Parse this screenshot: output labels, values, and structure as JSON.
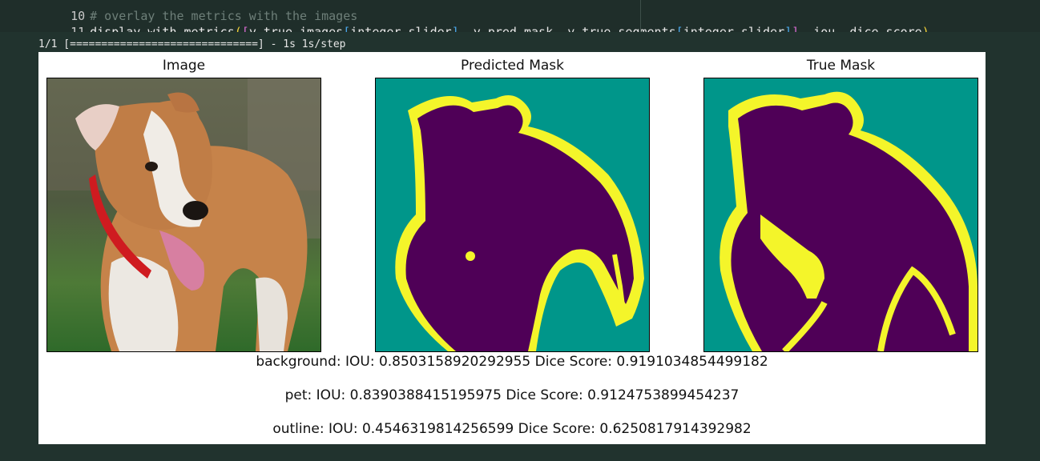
{
  "code": {
    "line10": {
      "number": "10",
      "comment": "# overlay the metrics with the images"
    },
    "line11": {
      "number": "11",
      "func": "display_with_metrics",
      "arg1": "y_true_images",
      "idx1": "integer_slider",
      "arg2": ", y_pred_mask, ",
      "arg3": "y_true_segments",
      "idx2": "integer_slider",
      "rest": ", iou, dice_score"
    }
  },
  "stdout": "1/1 [==============================] - 1s 1s/step",
  "figure": {
    "titles": [
      "Image",
      "Predicted Mask",
      "True Mask"
    ],
    "metrics": [
      "background: IOU: 0.8503158920292955 Dice Score: 0.9191034854499182",
      "pet: IOU: 0.8390388415195975 Dice Score: 0.9124753899454237",
      "outline: IOU: 0.4546319814256599 Dice Score: 0.6250817914392982"
    ]
  },
  "colors": {
    "mask_background": "#00968a",
    "mask_pet": "#4f0057",
    "mask_outline": "#f4f52a"
  }
}
